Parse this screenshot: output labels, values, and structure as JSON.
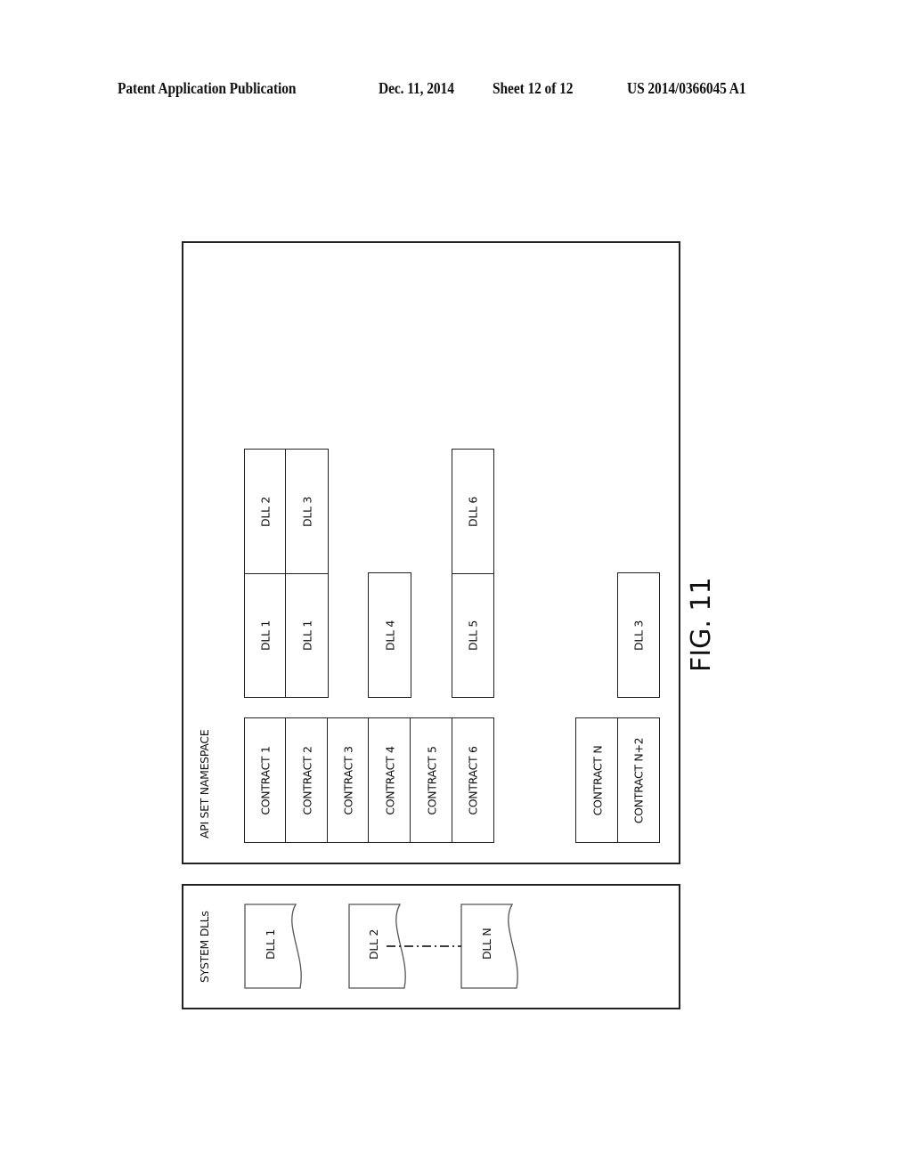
{
  "header": {
    "publication": "Patent Application Publication",
    "date": "Dec. 11, 2014",
    "sheet": "Sheet 12 of 12",
    "number": "US 2014/0366045 A1"
  },
  "figure_label": "FIG. 11",
  "api_set_namespace": {
    "label": "API SET NAMESPACE",
    "contracts": [
      {
        "label": "CONTRACT 1",
        "dlls": [
          "DLL 1",
          "DLL 2"
        ]
      },
      {
        "label": "CONTRACT 2",
        "dlls": [
          "DLL 1",
          "DLL 3"
        ]
      },
      {
        "label": "CONTRACT 3",
        "dlls": []
      },
      {
        "label": "CONTRACT 4",
        "dlls": [
          "DLL 4"
        ]
      },
      {
        "label": "CONTRACT 5",
        "dlls": []
      },
      {
        "label": "CONTRACT 6",
        "dlls": [
          "DLL 5",
          "DLL 6"
        ]
      }
    ],
    "contracts_tail": [
      {
        "label": "CONTRACT N",
        "dlls": []
      },
      {
        "label": "CONTRACT N+2",
        "dlls": [
          "DLL 3"
        ]
      }
    ]
  },
  "system_dlls": {
    "label": "SYSTEM DLLs",
    "items": [
      "DLL 1",
      "DLL 2",
      "DLL N"
    ]
  }
}
